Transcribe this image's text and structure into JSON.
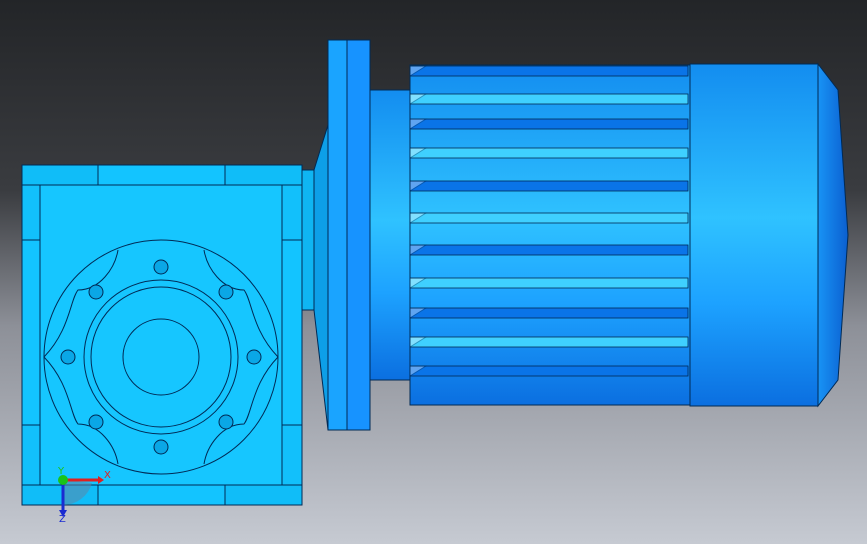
{
  "viewport": {
    "background_top": "#26282b",
    "background_bottom": "#c4c8d0"
  },
  "model": {
    "colors": {
      "body": "#13c4ff",
      "body_shade": "#0aa7e6",
      "motor": "#1ea8ff",
      "motor_dark": "#0a63d9",
      "motor_light": "#3fd0ff",
      "outline": "#002a55"
    }
  },
  "triad": {
    "x_label": "X",
    "y_label": "Y",
    "z_label": "Z",
    "x_color": "#e02020",
    "y_color": "#19c419",
    "z_color": "#1a2bd1"
  }
}
